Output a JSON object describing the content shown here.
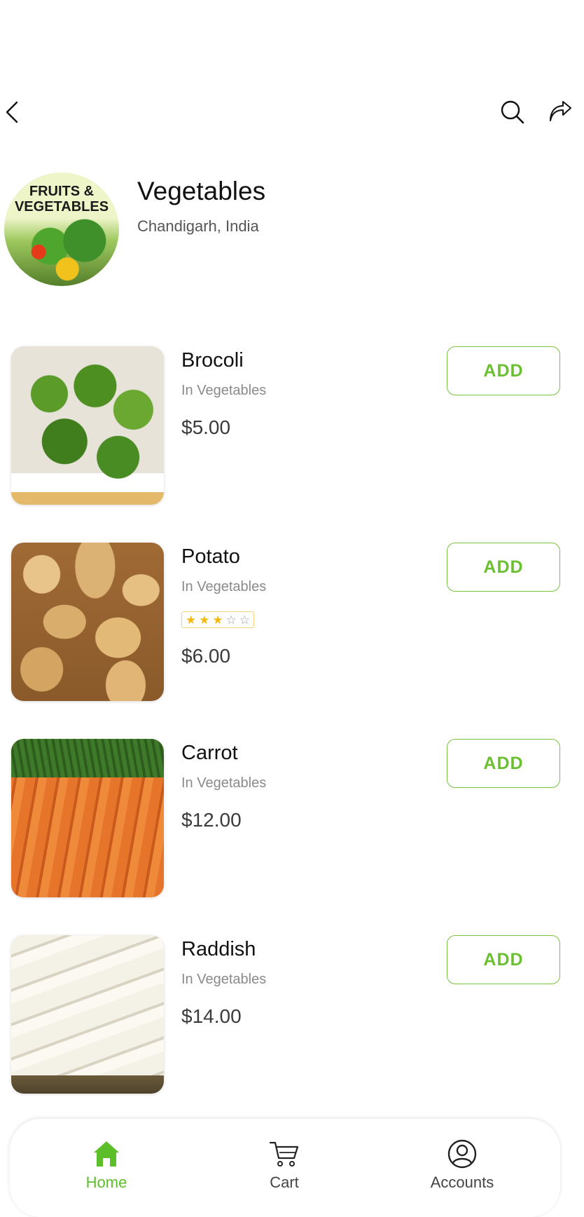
{
  "store": {
    "logo_text": "FRUITS & VEGETABLES",
    "title": "Vegetables",
    "location": "Chandigarh, India"
  },
  "header": {
    "back_icon": "chevron-left-icon",
    "search_icon": "search-icon",
    "share_icon": "share-icon"
  },
  "products": [
    {
      "name": "Brocoli",
      "category": "In Vegetables",
      "price": "$5.00",
      "add_label": "ADD"
    },
    {
      "name": "Potato",
      "category": "In Vegetables",
      "price": "$6.00",
      "add_label": "ADD",
      "rating": 3,
      "rating_max": 5
    },
    {
      "name": "Carrot",
      "category": "In Vegetables",
      "price": "$12.00",
      "add_label": "ADD"
    },
    {
      "name": "Raddish",
      "category": "In Vegetables",
      "price": "$14.00",
      "add_label": "ADD"
    }
  ],
  "nav": {
    "items": [
      {
        "label": "Home",
        "icon": "home-icon",
        "active": true
      },
      {
        "label": "Cart",
        "icon": "cart-icon",
        "active": false
      },
      {
        "label": "Accounts",
        "icon": "account-icon",
        "active": false
      }
    ]
  },
  "colors": {
    "accent": "#6cbf31",
    "star": "#f2b90f"
  }
}
